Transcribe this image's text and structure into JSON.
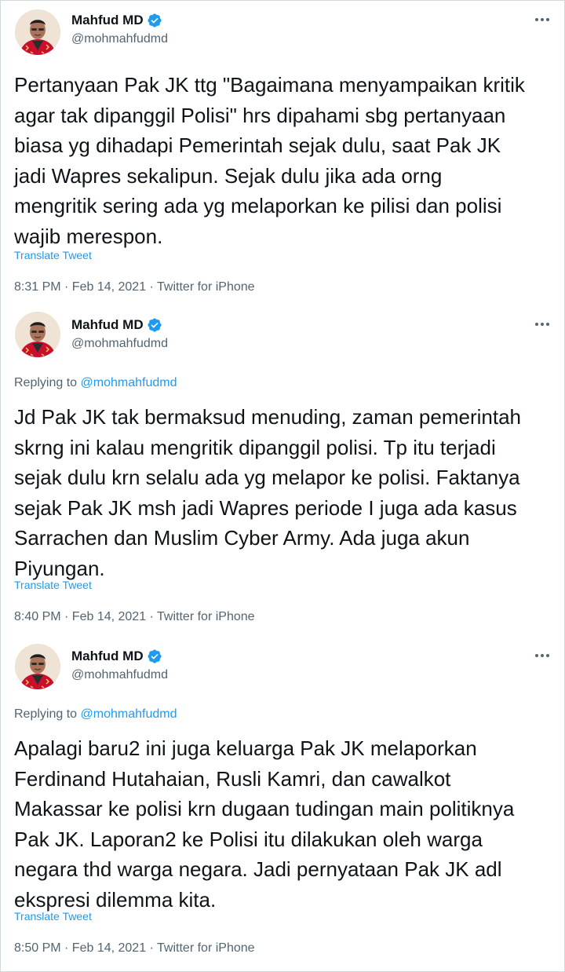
{
  "tweets": [
    {
      "author": {
        "name": "Mahfud MD",
        "handle": "@mohmahfudmd"
      },
      "replying_prefix": "",
      "replying_handle": "",
      "text": "Pertanyaan Pak JK ttg \"Bagaimana menyampaikan kritik\nagar tak dipanggil Polisi\" hrs dipahami sbg pertanyaan\nbiasa yg dihadapi Pemerintah sejak dulu, saat Pak JK\njadi Wapres sekalipun. Sejak dulu jika ada orng\nmengritik sering ada yg melaporkan ke pilisi dan polisi\nwajib merespon.",
      "translate_label": "Translate Tweet",
      "meta": "8:31 PM · Feb 14, 2021 · Twitter for iPhone"
    },
    {
      "author": {
        "name": "Mahfud MD",
        "handle": "@mohmahfudmd"
      },
      "replying_prefix": "Replying to ",
      "replying_handle": "@mohmahfudmd",
      "text": "Jd Pak JK tak bermaksud menuding, zaman pemerintah\nskrng ini kalau mengritik dipanggil polisi. Tp itu terjadi\nsejak dulu krn selalu ada yg melapor ke polisi. Faktanya\nsejak Pak JK msh jadi Wapres periode I juga ada kasus\nSarrachen dan Muslim Cyber Army. Ada juga akun\nPiyungan.",
      "translate_label": "Translate Tweet",
      "meta": "8:40 PM · Feb 14, 2021 · Twitter for iPhone"
    },
    {
      "author": {
        "name": "Mahfud MD",
        "handle": "@mohmahfudmd"
      },
      "replying_prefix": "Replying to ",
      "replying_handle": "@mohmahfudmd",
      "text": "Apalagi baru2 ini juga keluarga Pak JK melaporkan\nFerdinand Hutahaian, Rusli Kamri, dan cawalkot\nMakassar ke polisi krn dugaan tudingan main politiknya\nPak JK. Laporan2 ke Polisi itu dilakukan oleh warga\nnegara thd warga negara. Jadi pernyataan Pak JK adl\nekspresi dilemma kita.",
      "translate_label": "Translate Tweet",
      "meta": "8:50 PM · Feb 14, 2021 · Twitter for iPhone"
    }
  ],
  "colors": {
    "text_primary": "#0f1419",
    "text_secondary": "#536471",
    "accent": "#1d9bf0",
    "border": "#cfd9de",
    "shirt": "#c8102e"
  },
  "icons": [
    "avatar",
    "verified-badge-icon",
    "more-options-icon"
  ]
}
